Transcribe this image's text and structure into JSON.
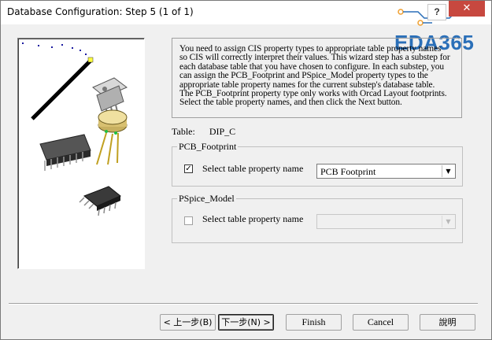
{
  "window": {
    "title": "Database Configuration: Step 5 (1 of 1)",
    "help_label": "?",
    "close_label": "✕",
    "watermark": "EDA365"
  },
  "description": {
    "lines": [
      "You need to assign CIS property types to appropriate table property names",
      "so CIS will correctly interpret their values. This wizard step has a substep for",
      "each database table that you have chosen to configure. In each substep, you",
      "can assign the PCB_Footprint and PSpice_Model property types to the",
      "appropriate table property names for the current substep's database table.",
      "The PCB_Footprint property type only works with Orcad Layout footprints.",
      "Select the table property names, and then click the Next button."
    ]
  },
  "table": {
    "label": "Table:",
    "value": "DIP_C"
  },
  "pcb_footprint": {
    "group_label": "PCB_Footprint",
    "checkbox_label": "Select table property name",
    "checked": true,
    "selected_value": "PCB Footprint"
  },
  "pspice_model": {
    "group_label": "PSpice_Model",
    "checkbox_label": "Select table property name",
    "checked": false,
    "selected_value": ""
  },
  "buttons": {
    "back": "< 上一步(B)",
    "next": "下一步(N) >",
    "finish": "Finish",
    "cancel": "Cancel",
    "help": "說明"
  },
  "colors": {
    "close_button": "#c7483f",
    "watermark": "#2a6fb8",
    "circuit_accent": "#f0a030"
  },
  "icons": {
    "checkbox_checked": "check-icon",
    "dropdown": "chevron-down-icon"
  }
}
